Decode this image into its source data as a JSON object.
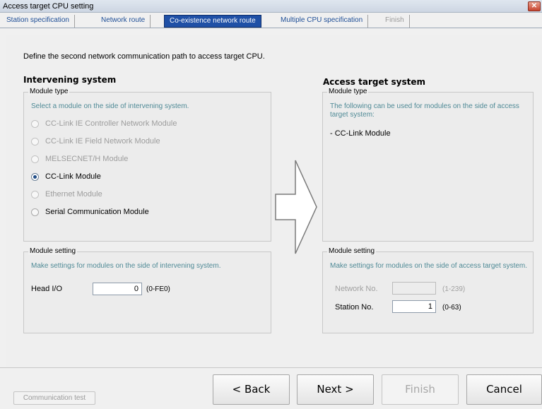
{
  "window": {
    "title": "Access target CPU setting",
    "close_glyph": "✕"
  },
  "tabs": [
    {
      "label": "Station specification"
    },
    {
      "label": "Network route"
    },
    {
      "label": "Co-existence network route"
    },
    {
      "label": "Multiple CPU specification"
    },
    {
      "label": "Finish"
    }
  ],
  "intro": "Define the second network communication path to access target CPU.",
  "intervening": {
    "heading": "Intervening system",
    "module_type": {
      "legend": "Module type",
      "hint": "Select a module on the side of intervening system.",
      "options": [
        {
          "label": "CC-Link IE Controller Network Module",
          "state": "disabled"
        },
        {
          "label": "CC-Link IE Field Network Module",
          "state": "disabled"
        },
        {
          "label": "MELSECNET/H Module",
          "state": "disabled"
        },
        {
          "label": "CC-Link Module",
          "state": "checked"
        },
        {
          "label": "Ethernet Module",
          "state": "disabled"
        },
        {
          "label": "Serial Communication Module",
          "state": "enabled"
        }
      ]
    },
    "module_setting": {
      "legend": "Module setting",
      "hint": "Make settings for modules on the side of intervening system.",
      "head_io_label": "Head I/O",
      "head_io_value": "0",
      "head_io_range": "(0-FE0)"
    }
  },
  "target": {
    "heading": "Access target system",
    "module_type": {
      "legend": "Module type",
      "hint": "The following can be used for modules on the side of access target system:",
      "item": "- CC-Link Module"
    },
    "module_setting": {
      "legend": "Module setting",
      "hint": "Make settings for modules on the side of access target system.",
      "network_label": "Network No.",
      "network_value": "",
      "network_range": "(1-239)",
      "station_label": "Station No.",
      "station_value": "1",
      "station_range": "(0-63)"
    }
  },
  "buttons": {
    "communication_test": "Communication test",
    "back": "< Back",
    "next": "Next >",
    "finish": "Finish",
    "cancel": "Cancel"
  }
}
